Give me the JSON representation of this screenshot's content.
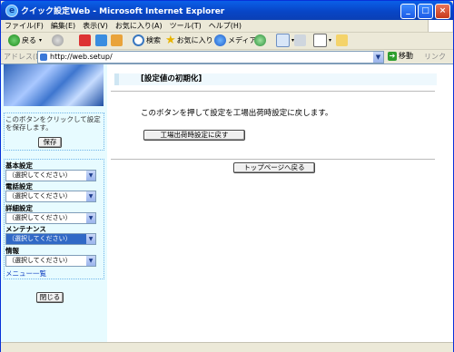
{
  "window": {
    "title": "クイック設定Web - Microsoft Internet Explorer",
    "controls": [
      "_",
      "□",
      "×"
    ]
  },
  "menubar": {
    "items": [
      "ファイル(F)",
      "編集(E)",
      "表示(V)",
      "お気に入り(A)",
      "ツール(T)",
      "ヘルプ(H)"
    ]
  },
  "toolbar": {
    "back_label": "戻る",
    "search_label": "検索",
    "favorites_label": "お気に入り",
    "media_label": "メディア"
  },
  "address": {
    "label": "アドレス(D)",
    "url": "http://web.setup/",
    "go_label": "移動",
    "links_label": "リンク"
  },
  "sidebar": {
    "save_note": "このボタンをクリックして設定を保存します。",
    "save_button": "保存",
    "groups": [
      {
        "label": "基本設定",
        "value": "（選択してください）"
      },
      {
        "label": "電話設定",
        "value": "（選択してください）"
      },
      {
        "label": "詳細設定",
        "value": "（選択してください）"
      },
      {
        "label": "メンテナンス",
        "value": "（選択してください）"
      },
      {
        "label": "情報",
        "value": "（選択してください）"
      }
    ],
    "menu_link": "メニュー一覧",
    "close_button": "閉じる"
  },
  "main": {
    "section_title": "[設定値の初期化]",
    "message": "このボタンを押して設定を工場出荷時設定に戻します。",
    "reset_button": "工場出荷時設定に戻す",
    "top_button": "トップページへ戻る"
  },
  "colors": {
    "sidebar_bg": "#e7fbff",
    "title_bar": "#0a5fe8",
    "selected_dropdown": "#3169c6"
  }
}
